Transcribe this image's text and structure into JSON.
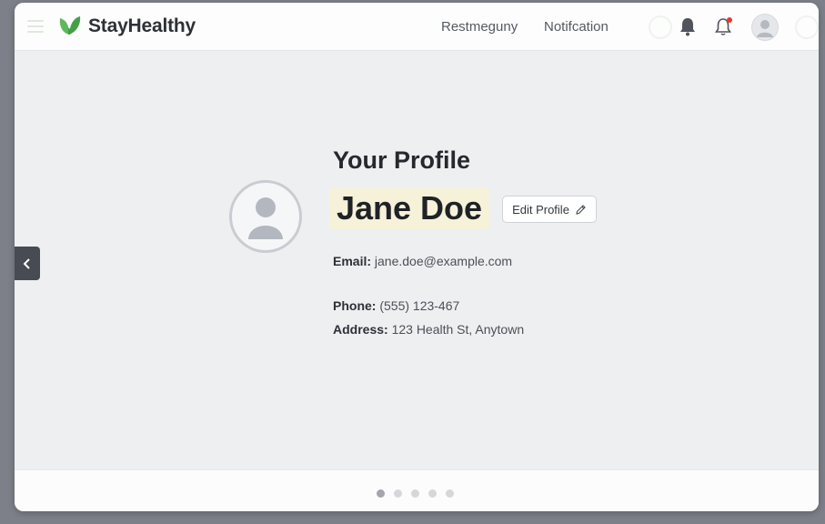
{
  "header": {
    "brand": "StayHealthy",
    "nav": [
      "Restmeguny",
      "Notifcation"
    ],
    "icons": [
      "menu-icon",
      "leaf-logo-icon",
      "bell-icon",
      "bell-notification-icon",
      "user-avatar-icon"
    ],
    "accent": "#4caf50",
    "notification_dot_color": "#e53935"
  },
  "profile": {
    "heading": "Your Profile",
    "name": "Jane Doe",
    "edit_label": "Edit Profile",
    "email_label": "Email:",
    "email": "jane.doe@example.com",
    "phone_label": "Phone:",
    "phone": "(555) 123-467",
    "address_label": "Address:",
    "address": "123 Health St, Anytown"
  },
  "pagination": {
    "count": 5,
    "active": 1
  },
  "colors": {
    "name_highlight": "#f6f2d9",
    "side_arrow": "#474b53"
  }
}
